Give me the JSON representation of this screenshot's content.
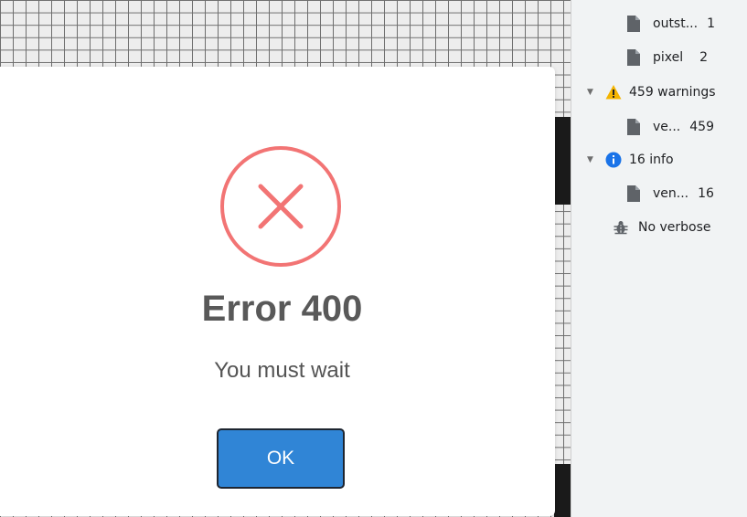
{
  "dialog": {
    "title": "Error 400",
    "message": "You must wait",
    "ok_label": "OK",
    "icon": "error-x-icon",
    "icon_color": "#f27474",
    "button_color": "#3085d6"
  },
  "sidebar": {
    "items": [
      {
        "label": "outst...",
        "count": "1",
        "icon": "file-icon"
      },
      {
        "label": "pixel",
        "count": "2",
        "icon": "file-icon"
      },
      {
        "label": "459 warnings",
        "icon": "warning-icon",
        "color": "#f4b400"
      },
      {
        "label": "ve...",
        "count": "459",
        "icon": "file-icon"
      },
      {
        "label": "16 info",
        "icon": "info-icon",
        "color": "#1a73e8"
      },
      {
        "label": "ven...",
        "count": "16",
        "icon": "file-icon"
      },
      {
        "label": "No verbose",
        "icon": "bug-icon"
      }
    ]
  }
}
